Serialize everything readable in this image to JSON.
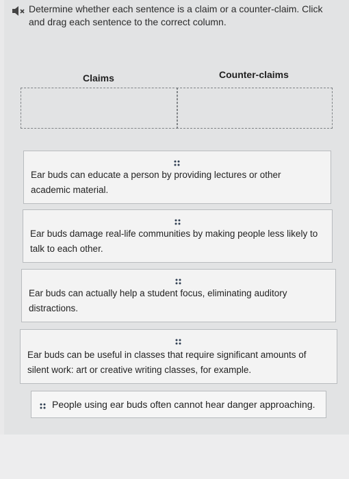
{
  "instructions": {
    "icon": "speaker-muted-icon",
    "text": "Determine whether each sentence is a claim or a counter-claim. Click and drag each sentence to the correct column."
  },
  "columns": {
    "claims_label": "Claims",
    "counterclaims_label": "Counter-claims"
  },
  "sentences": [
    {
      "text": "Ear buds can educate a person by providing lectures or other academic material."
    },
    {
      "text": "Ear buds damage real-life communities by making people less likely to talk to each other."
    },
    {
      "text": "Ear buds can actually help a student focus, eliminating auditory distractions."
    },
    {
      "text": "Ear buds can be useful in classes that require significant amounts of silent work: art or creative writing classes, for example."
    },
    {
      "text": "People using ear buds often cannot hear danger approaching."
    }
  ],
  "icons": {
    "drag_handle": "drag-grip-icon"
  },
  "colors": {
    "panel_background": "#e2e3e4",
    "card_background": "#f3f3f3",
    "card_border": "#b8bbbe",
    "dropzone_border": "#7e8285",
    "grip_color": "#2f3e52"
  }
}
